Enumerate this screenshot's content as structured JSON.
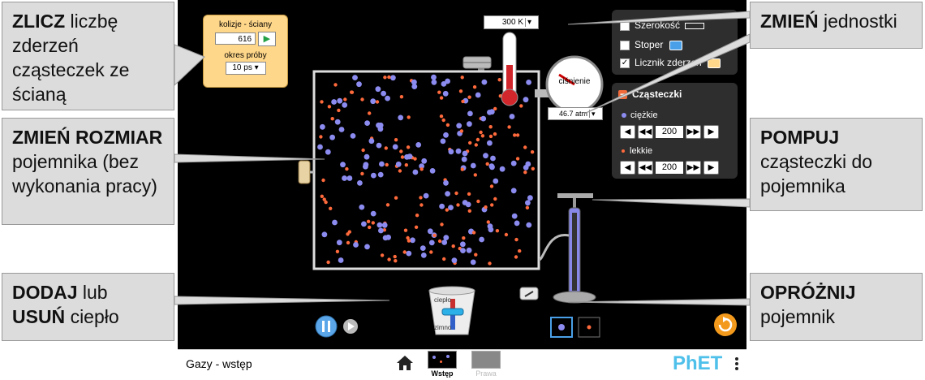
{
  "callouts": {
    "count": {
      "bold": "ZLICZ",
      "rest": "liczbę zderzeń cząsteczek ze ścianą"
    },
    "resize": {
      "bold": "ZMIEŃ ROZMIAR",
      "rest": "pojemnika (bez wykonania pracy)"
    },
    "heat": {
      "bold1": "DODAJ",
      "mid": "lub",
      "bold2": "USUŃ",
      "rest": "ciepło"
    },
    "units": {
      "bold": "ZMIEŃ",
      "rest": "jednostki"
    },
    "pump": {
      "bold": "POMPUJ",
      "rest": "cząsteczki do pojemnika"
    },
    "empty": {
      "bold": "OPRÓŻNIJ",
      "rest": "pojemnik"
    }
  },
  "collision_counter": {
    "title": "kolizje - ściany",
    "value": "616",
    "sample_label": "okres próby",
    "sample_value": "10 ps"
  },
  "thermometer": {
    "value": "300 K"
  },
  "gauge": {
    "label": "ciśnienie",
    "value": "46.7 atm"
  },
  "options": {
    "width": "Szerokość",
    "stopwatch": "Stoper",
    "collision": "Licznik zderzeń"
  },
  "particles": {
    "title": "Cząsteczki",
    "heavy_label": "ciężkie",
    "heavy_count": "200",
    "light_label": "lekkie",
    "light_count": "200"
  },
  "heater": {
    "hot": "ciepło",
    "cold": "zimno"
  },
  "navbar": {
    "title": "Gazy - wstęp",
    "screen1": "Wstęp",
    "screen2": "Prawa",
    "logo": "PhET"
  },
  "colors": {
    "heavy": "#8b8bf0",
    "light": "#ff6a3c",
    "accent": "#ffd78a"
  }
}
